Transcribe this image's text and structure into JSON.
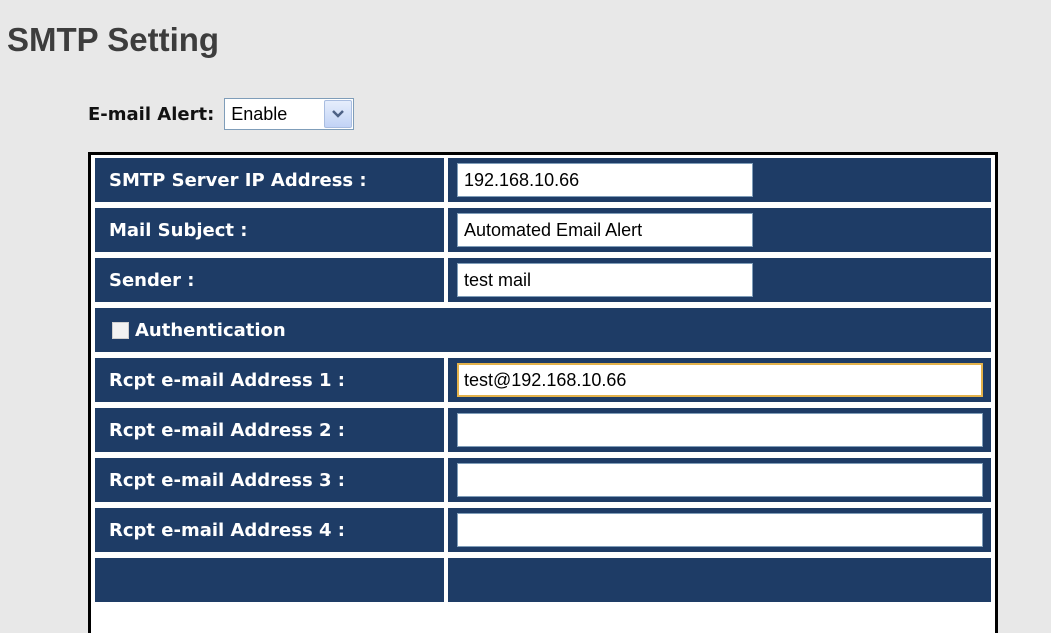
{
  "page": {
    "title": "SMTP Setting"
  },
  "email_alert": {
    "label": "E-mail Alert:",
    "selected": "Enable"
  },
  "form": {
    "smtp_server": {
      "label": "SMTP Server IP Address :",
      "value": "192.168.10.66"
    },
    "mail_subject": {
      "label": "Mail Subject :",
      "value": "Automated Email Alert"
    },
    "sender": {
      "label": "Sender :",
      "value": "test mail"
    },
    "authentication": {
      "label": "Authentication",
      "checked": false
    },
    "recipients": [
      {
        "label": "Rcpt e-mail Address 1 :",
        "value": "test@192.168.10.66"
      },
      {
        "label": "Rcpt e-mail Address 2 :",
        "value": ""
      },
      {
        "label": "Rcpt e-mail Address 3 :",
        "value": ""
      },
      {
        "label": "Rcpt e-mail Address 4 :",
        "value": ""
      }
    ]
  },
  "colors": {
    "page_background": "#e8e8e8",
    "header_cell": "#1e3c66",
    "table_border": "#000000",
    "input_border": "#7f9db9",
    "focus_border": "#e3b24b"
  }
}
